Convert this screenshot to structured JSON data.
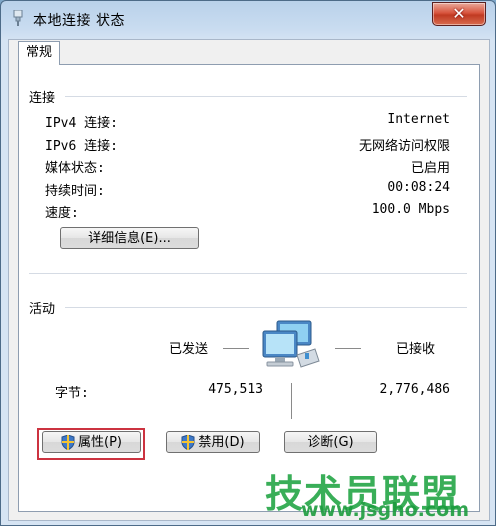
{
  "window": {
    "title": "本地连接 状态",
    "close_glyph": "✕"
  },
  "tab": {
    "label": "常规"
  },
  "connection": {
    "section_label": "连接",
    "rows": [
      {
        "label": "IPv4 连接:",
        "value": "Internet"
      },
      {
        "label": "IPv6 连接:",
        "value": "无网络访问权限"
      },
      {
        "label": "媒体状态:",
        "value": "已启用"
      },
      {
        "label": "持续时间:",
        "value": "00:08:24"
      },
      {
        "label": "速度:",
        "value": "100.0 Mbps"
      }
    ],
    "details_button": "详细信息(E)..."
  },
  "activity": {
    "section_label": "活动",
    "sent_label": "已发送",
    "received_label": "已接收",
    "bytes_label": "字节:",
    "bytes_sent": "475,513",
    "bytes_received": "2,776,486"
  },
  "buttons": {
    "properties": "属性(P)",
    "disable": "禁用(D)",
    "diagnose": "诊断(G)"
  },
  "watermark": {
    "main": "技术员联盟",
    "sub": "www.jsgho.com"
  },
  "colors": {
    "highlight_border": "#cc3340",
    "watermark": "#29a84a",
    "close_button": "#c03a22"
  },
  "icons": [
    "network-connection-icon",
    "close-icon",
    "shield-icon",
    "network-computers-icon"
  ]
}
